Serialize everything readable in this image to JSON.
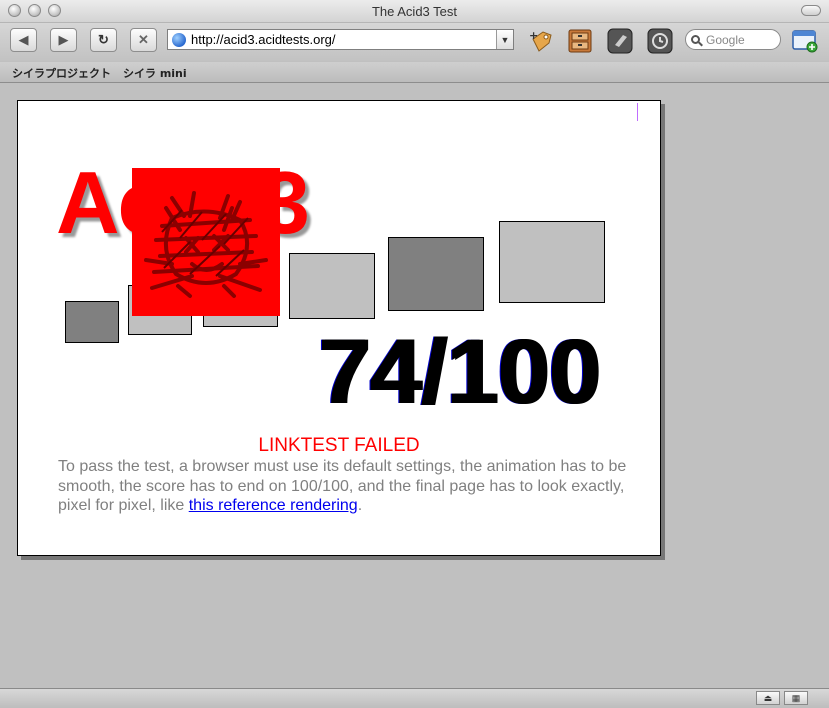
{
  "window": {
    "title": "The Acid3 Test"
  },
  "toolbar": {
    "back_icon": "back-arrow-icon",
    "forward_icon": "forward-arrow-icon",
    "reload_icon": "reload-icon",
    "stop_icon": "stop-icon",
    "address_url": "http://acid3.acidtests.org/",
    "search_placeholder": "Google"
  },
  "bookmarks": {
    "items": [
      "シイラプロジェクト",
      "シイラ mini"
    ]
  },
  "page": {
    "heading_left": "Ac",
    "heading_right": "3",
    "score": "74/100",
    "status": "LINKTEST FAILED",
    "explanation": "To pass the test, a browser must use its default settings, the animation has to be smooth, the score has to end on 100/100, and the final page has to look exactly, pixel for pixel, like ",
    "link_text": "this reference rendering",
    "explanation_end": "."
  },
  "colors": {
    "heading": "#ff0000",
    "score": "#000000",
    "status": "#ff0000",
    "explanation": "#808080",
    "link": "#0000ee",
    "box_dark": "#808080",
    "box_light": "#c0c0c0"
  }
}
